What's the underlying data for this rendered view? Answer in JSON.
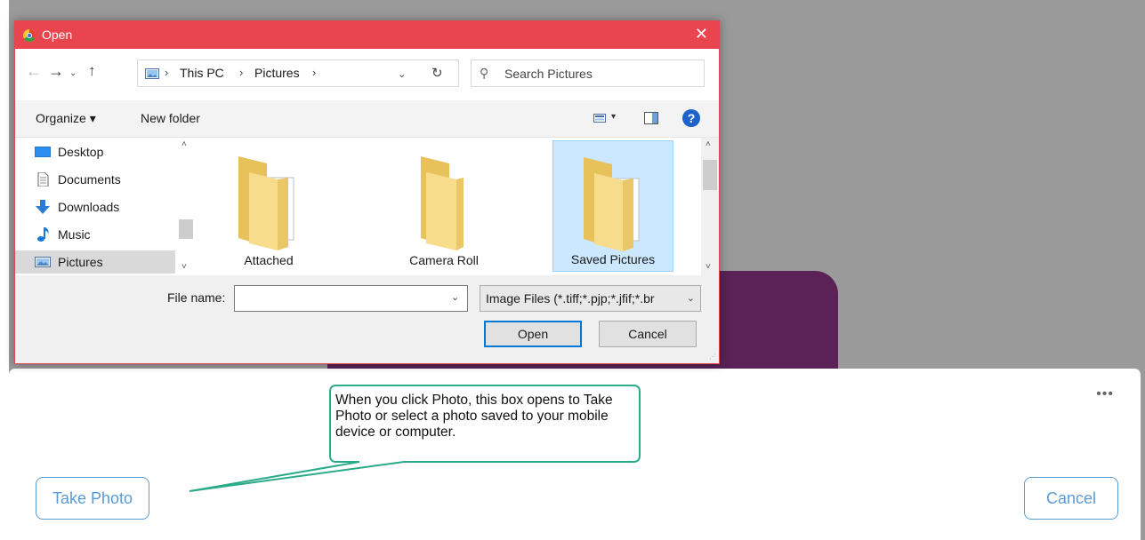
{
  "dialog": {
    "title": "Open",
    "close_glyph": "✕",
    "nav": {
      "back": "←",
      "forward": "→",
      "recent": "⌄",
      "up": "↑"
    },
    "breadcrumb": [
      "This PC",
      "Pictures"
    ],
    "breadcrumb_sep": "›",
    "address_drop": "⌄",
    "refresh": "↻",
    "search_placeholder": "Search Pictures",
    "toolbar": {
      "organize": "Organize ▾",
      "new_folder": "New folder",
      "view_drop": "▾",
      "help": "?"
    },
    "nav_items": [
      {
        "label": "Desktop",
        "icon": "desktop-icon"
      },
      {
        "label": "Documents",
        "icon": "documents-icon"
      },
      {
        "label": "Downloads",
        "icon": "downloads-icon"
      },
      {
        "label": "Music",
        "icon": "music-icon"
      },
      {
        "label": "Pictures",
        "icon": "pictures-icon",
        "selected": true
      }
    ],
    "folders": [
      {
        "name": "Attached",
        "has_contents": true
      },
      {
        "name": "Camera Roll",
        "has_contents": false
      },
      {
        "name": "Saved Pictures",
        "has_contents": true,
        "selected": true
      }
    ],
    "scroll_up": "˄",
    "scroll_down": "˅",
    "file_name_label": "File name:",
    "file_name_value": "",
    "file_name_drop": "⌄",
    "file_type_value": "Image Files (*.tiff;*.pjp;*.jfif;*.br",
    "file_type_drop": "⌄",
    "open_label": "Open",
    "cancel_label": "Cancel",
    "colors": {
      "titlebar": "#e8454f",
      "accent": "#0078d7",
      "selection": "#cce8ff"
    }
  },
  "callout": {
    "text": "When you click Photo, this box opens to Take Photo or select a photo saved to your mobile device or computer.",
    "border_color": "#2cab8a"
  },
  "sheet": {
    "more": "•••",
    "take_photo_label": "Take Photo",
    "cancel_label": "Cancel",
    "accent": "#5b9bd5"
  },
  "background": {
    "purple": "#5a2256",
    "gray": "#9a9a9a"
  }
}
